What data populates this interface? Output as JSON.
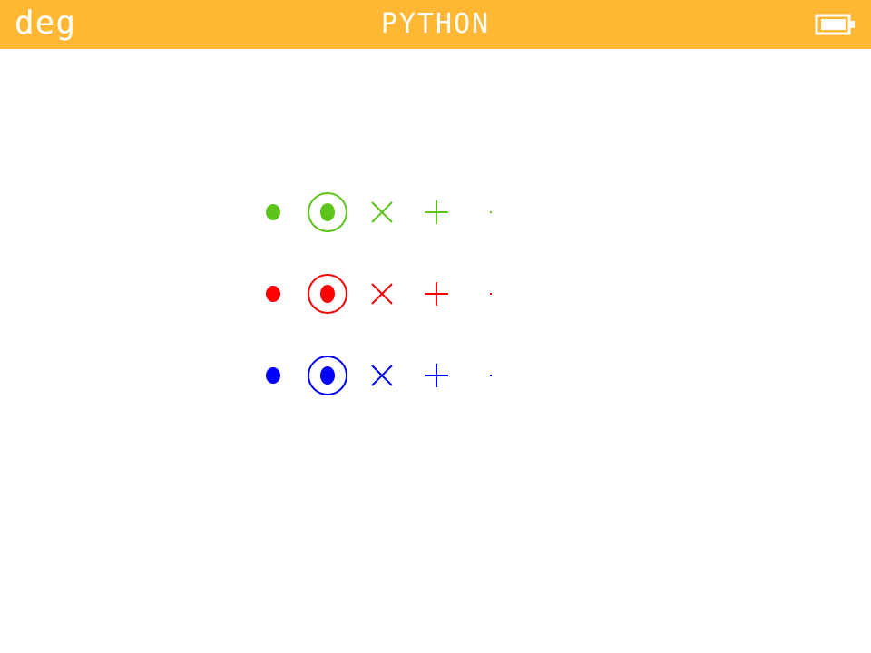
{
  "status_bar": {
    "angle_mode": "deg",
    "title": "PYTHON",
    "battery_icon": "battery-full-icon",
    "background": "#FFB734",
    "text_color": "#FFFFFF"
  },
  "canvas": {
    "background": "#FFFFFF",
    "marker_rows": [
      {
        "name": "green",
        "color": "#5CC41A",
        "markers": [
          "point",
          "circle-dot",
          "x",
          "plus",
          "pixel"
        ]
      },
      {
        "name": "red",
        "color": "#FF0000",
        "markers": [
          "point",
          "circle-dot",
          "x",
          "plus",
          "pixel"
        ]
      },
      {
        "name": "blue",
        "color": "#0000FF",
        "markers": [
          "point",
          "circle-dot",
          "x",
          "plus",
          "pixel"
        ]
      }
    ]
  }
}
